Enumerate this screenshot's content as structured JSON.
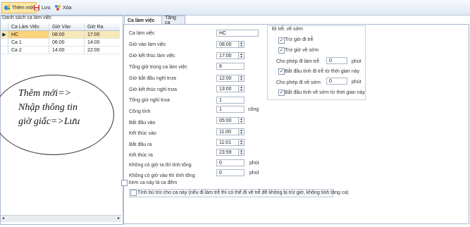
{
  "toolbar": {
    "add_label": "Thêm mới",
    "save_label": "Lưu",
    "delete_label": "Xóa"
  },
  "left": {
    "title": "Danh sách ca làm việc",
    "columns": [
      "Ca Làm Việc",
      "Giờ Vào",
      "Giờ Ra"
    ],
    "rows": [
      {
        "shift": "HC",
        "in": "08:00",
        "out": "17:00"
      },
      {
        "shift": "Ca 1",
        "in": "06:00",
        "out": "14:00"
      },
      {
        "shift": "Ca 2",
        "in": "14:00",
        "out": "22:00"
      }
    ]
  },
  "note": {
    "line1": "Thêm mới=>",
    "line2": "Nhập thông tin",
    "line3": "giờ giấc=>Lưu"
  },
  "tabs": [
    "Ca làm việc",
    "Tăng ca"
  ],
  "form": {
    "ca_lam_viec": {
      "label": "Ca làm việc",
      "value": "HC"
    },
    "gio_vao": {
      "label": "Giờ vào làm việc",
      "value": "08:00"
    },
    "gio_ket_thuc": {
      "label": "Giờ kết thúc làm việc",
      "value": "17:00"
    },
    "tong_gio": {
      "label": "Tổng giờ trong ca làm việc",
      "value": "8"
    },
    "bat_dau_nghi": {
      "label": "Giờ bắt đầu nghỉ trưa",
      "value": "12:00"
    },
    "ket_thuc_nghi": {
      "label": "Giờ kết thúc nghỉ trưa",
      "value": "13:00"
    },
    "tong_nghi": {
      "label": "Tổng giờ nghỉ trưa",
      "value": "1"
    },
    "cong_tinh": {
      "label": "Công tính",
      "value": "1",
      "unit": "công"
    },
    "bat_dau_vao": {
      "label": "Bắt đầu vào",
      "value": "05:00"
    },
    "ket_thuc_vao": {
      "label": "Kết thúc vào",
      "value": "11:00"
    },
    "bat_dau_ra": {
      "label": "Bắt đầu ra",
      "value": "11:01"
    },
    "ket_thuc_ra": {
      "label": "Kết thúc ra",
      "value": "23:59"
    },
    "khong_ra": {
      "label": "Không có giờ ra thì tính tổng",
      "value": "0",
      "unit": "phút"
    },
    "khong_vao": {
      "label": "Không có giờ vào thì tính tổng",
      "value": "0",
      "unit": "phút"
    },
    "xem_ca_dem": {
      "label": "Xem ca này là ca đêm",
      "checked": false
    },
    "tinh_bu": {
      "label": "Tính bù trừ cho ca này (nếu đi làm trễ thì có thể đi về trễ để không bị trừ giờ, không tính tăng ca)",
      "checked": false
    }
  },
  "late_group": {
    "title": "Đi trễ, về sớm",
    "tru_di_tre": {
      "label": "Trừ giờ đi trễ",
      "checked": true
    },
    "tru_ve_som": {
      "label": "Trừ giờ về sớm",
      "checked": true
    },
    "cho_phep_tre": {
      "label": "Cho phép đi làm trễ",
      "value": "0",
      "unit": "phút"
    },
    "bat_dau_tre": {
      "label": "Bắt đầu tính đi trễ từ thời gian này",
      "checked": true
    },
    "cho_phep_som": {
      "label": "Cho phép đi về sớm",
      "value": "0",
      "unit": "phút"
    },
    "bat_dau_som": {
      "label": "Bắt đầu tính về sớm từ thời gian này",
      "checked": true
    }
  }
}
